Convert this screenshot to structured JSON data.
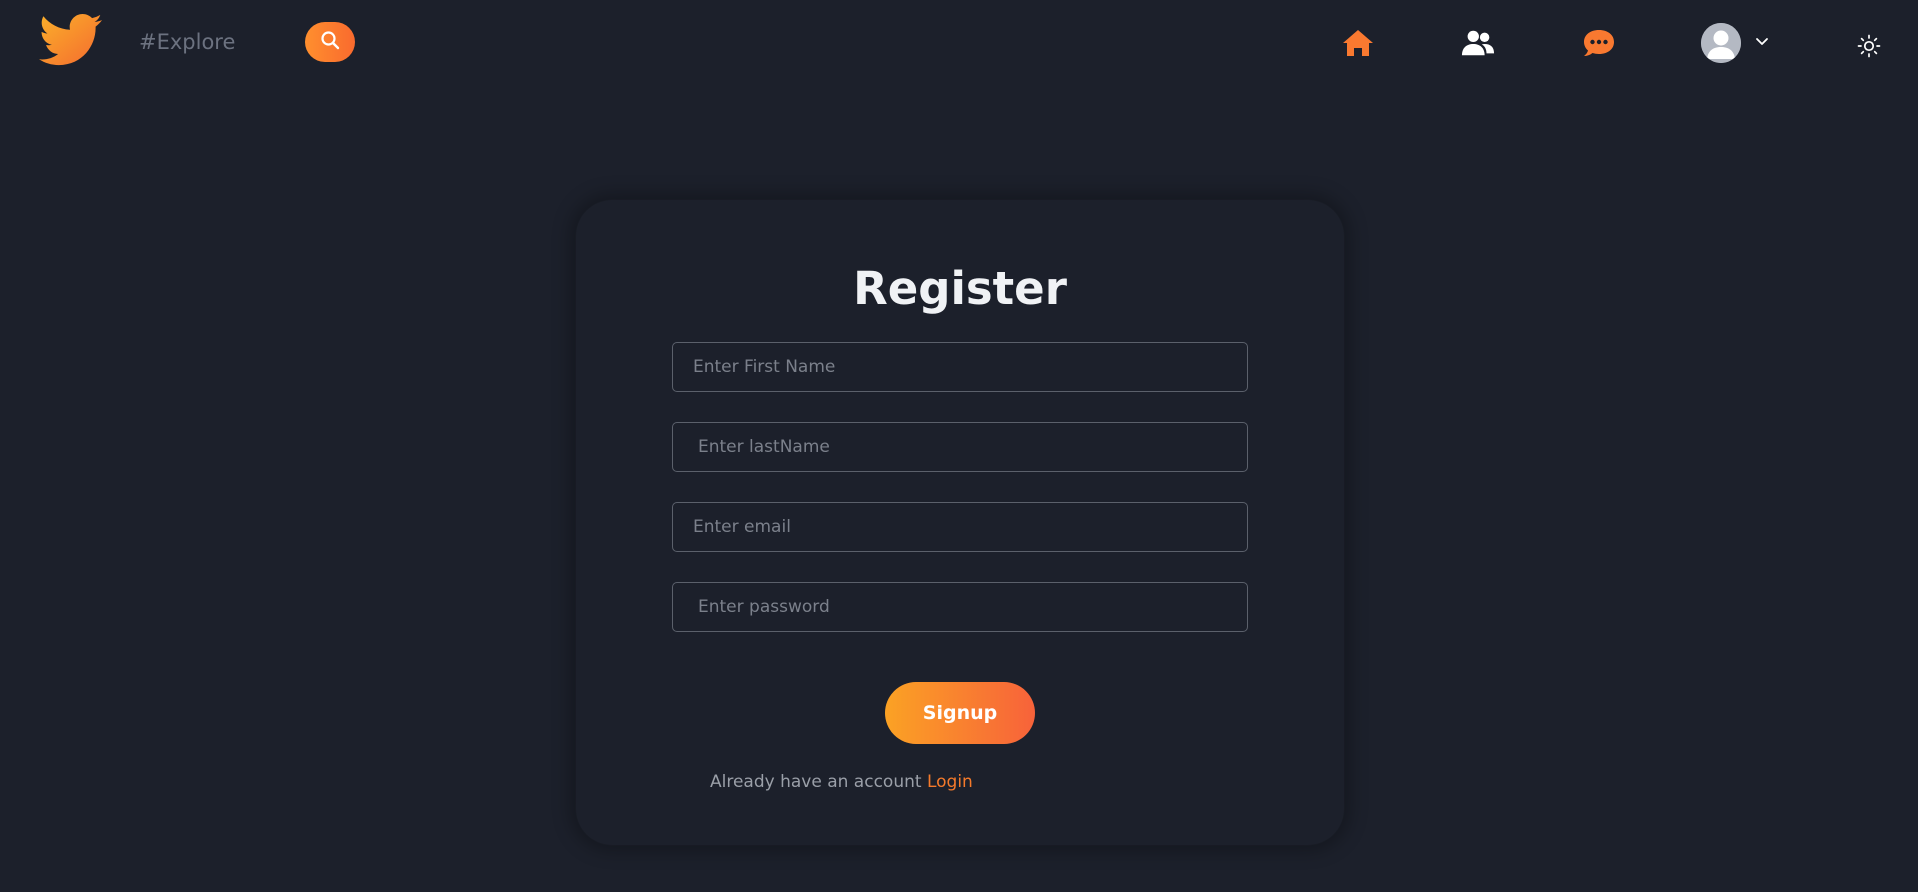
{
  "app": {
    "brand_icon": "bird-logo-icon",
    "accent": "#f7782e"
  },
  "header": {
    "explore_placeholder": "#Explore",
    "search_icon": "search-icon",
    "nav": [
      {
        "name": "home",
        "icon": "home-icon",
        "color": "#f97930"
      },
      {
        "name": "friends",
        "icon": "users-icon",
        "color": "#ffffff"
      },
      {
        "name": "messages",
        "icon": "chat-icon",
        "color": "#f97930"
      }
    ],
    "profile": {
      "avatar_icon": "user-avatar-icon",
      "dropdown_icon": "chevron-down-icon"
    },
    "theme_icon": "sun-icon"
  },
  "register": {
    "title": "Register",
    "fields": {
      "first_name_placeholder": "Enter First Name",
      "last_name_placeholder": "Enter lastName",
      "email_placeholder": "Enter email",
      "password_placeholder": "Enter password"
    },
    "signup_label": "Signup",
    "already_text": "Already have an account ",
    "login_label": "Login"
  }
}
